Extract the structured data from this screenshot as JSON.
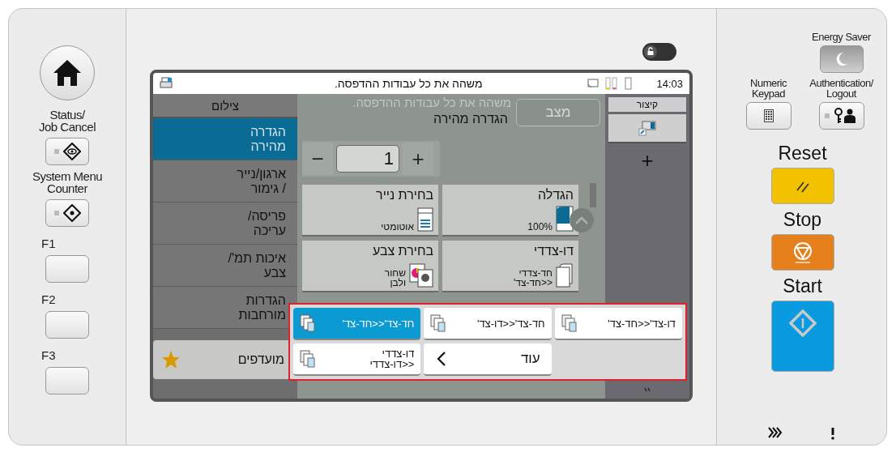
{
  "left_panel": {
    "buttons": [
      {
        "label": "Status/\nJob Cancel",
        "kind": "status"
      },
      {
        "label": "System Menu\nCounter",
        "kind": "system"
      },
      {
        "label": "F1",
        "kind": "function"
      },
      {
        "label": "F2",
        "kind": "function"
      },
      {
        "label": "F3",
        "kind": "function"
      }
    ]
  },
  "lock_toggle": {
    "on": false
  },
  "screen": {
    "status_bar": {
      "message": "משהה את כל עבודות ההדפסה.",
      "time": "14:03"
    },
    "sidebar": {
      "header": "צילום",
      "items": [
        {
          "label": "הגדרה\nמהירה",
          "selected": true
        },
        {
          "label": "ארגון/נייר\n/ גימור",
          "selected": false
        },
        {
          "label": "פריסה/\nעריכה",
          "selected": false
        },
        {
          "label": "איכות תמ'/\nצבע",
          "selected": false
        },
        {
          "label": "הגדרות\nמורחבות",
          "selected": false
        }
      ],
      "favorites": "מועדפים"
    },
    "main": {
      "ghost_message": "משהה את כל עבודות ההדפסה.",
      "title": "הגדרה מהירה",
      "status_button": "מצב",
      "copies": {
        "minus": "−",
        "value": "1",
        "plus": "+"
      },
      "tiles": [
        {
          "title": "הגדלה",
          "value": "100%",
          "kind": "zoom"
        },
        {
          "title": "בחירת נייר",
          "value": "אוטומטי",
          "kind": "paper"
        },
        {
          "title": "דו-צדדי",
          "value": "חד-צדדי\n<<חד-צד'",
          "kind": "duplex"
        },
        {
          "title": "בחירת צבע",
          "value": "שחור\nולבן",
          "kind": "color"
        }
      ]
    },
    "duplex_popup": {
      "options": [
        {
          "label": "דו-צד'<<חד-צד'",
          "selected": false
        },
        {
          "label": "חד-צד'<<דו-צד'",
          "selected": false
        },
        {
          "label": "חד-צד'<<חד-צד'",
          "selected": true
        },
        {
          "label": "דו-צדדי\n<<דו-צדדי",
          "selected": false
        }
      ],
      "more": "עוד"
    },
    "shortcut": {
      "header": "קיצור",
      "add": "+"
    }
  },
  "right_panel": {
    "energy_saver": {
      "label": "Energy Saver",
      "kind": "energy"
    },
    "numeric_keypad": {
      "label": "Numeric\nKeypad",
      "kind": "keypad"
    },
    "authentication": {
      "label": "Authentication/\nLogout",
      "kind": "auth"
    },
    "big_buttons": [
      {
        "label": "Reset",
        "kind": "reset"
      },
      {
        "label": "Stop",
        "kind": "stop"
      },
      {
        "label": "Start",
        "kind": "start"
      }
    ]
  }
}
